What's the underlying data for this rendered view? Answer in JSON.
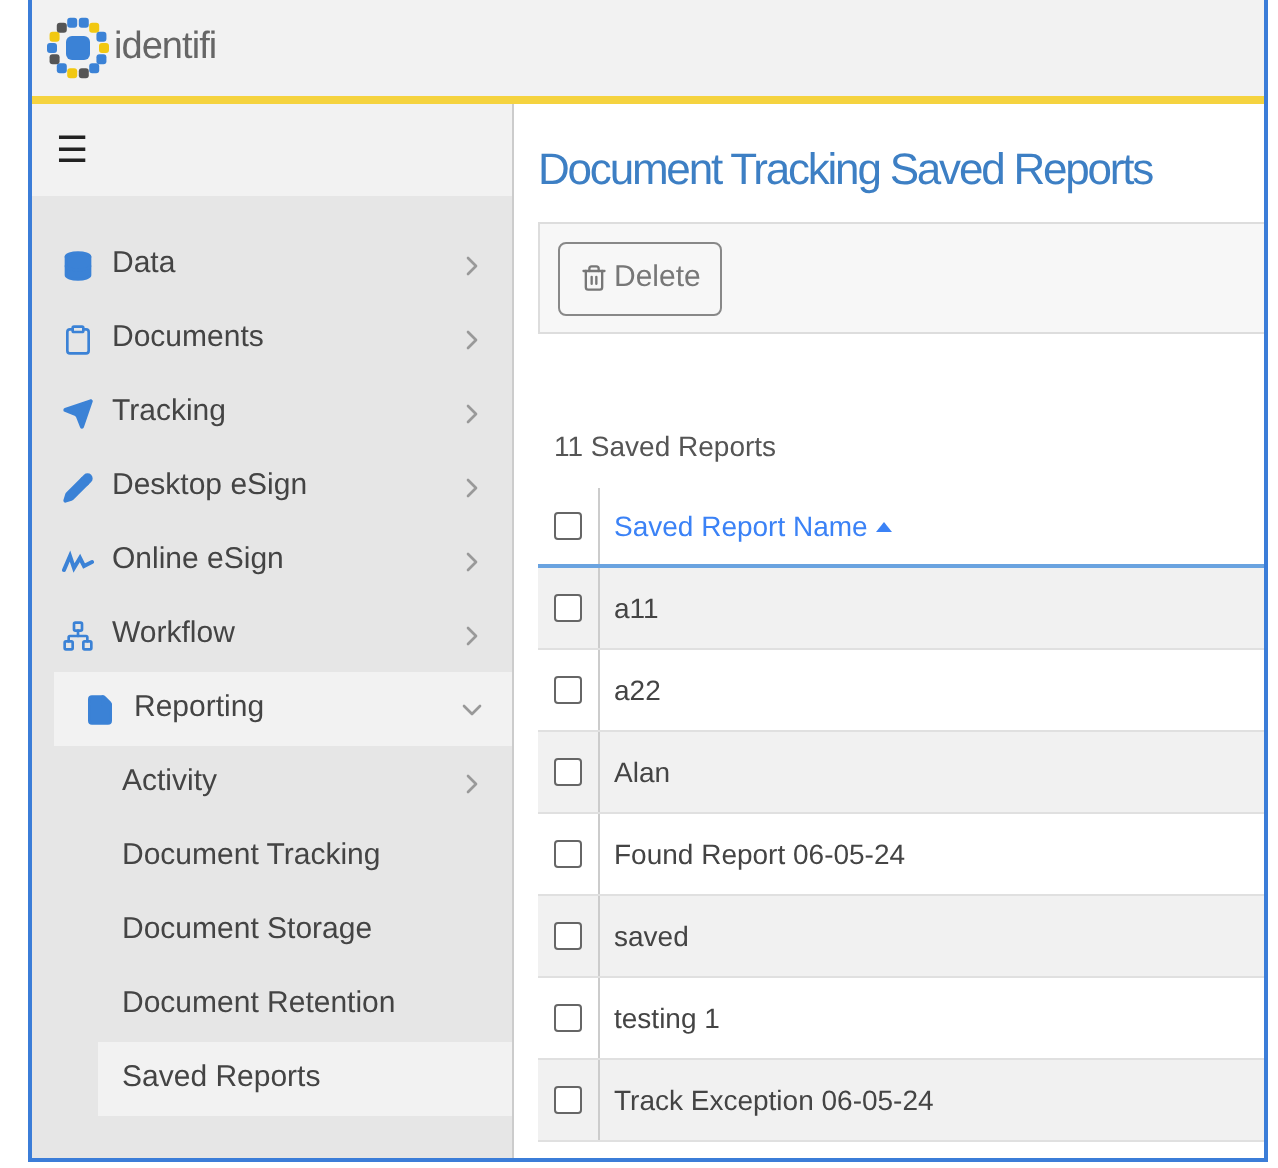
{
  "header": {
    "logo_text": "identifi",
    "menu_icon": "☰"
  },
  "sidebar": {
    "items": [
      {
        "label": "Data",
        "expanded": false
      },
      {
        "label": "Documents",
        "expanded": false
      },
      {
        "label": "Tracking",
        "expanded": false
      },
      {
        "label": "Desktop eSign",
        "expanded": false
      },
      {
        "label": "Online eSign",
        "expanded": false
      },
      {
        "label": "Workflow",
        "expanded": false
      },
      {
        "label": "Reporting",
        "expanded": true,
        "children": [
          {
            "label": "Activity",
            "selected": false,
            "has_submenu": true
          },
          {
            "label": "Document Tracking",
            "selected": false,
            "has_submenu": false
          },
          {
            "label": "Document Storage",
            "selected": false,
            "has_submenu": false
          },
          {
            "label": "Document Retention",
            "selected": false,
            "has_submenu": false
          },
          {
            "label": "Saved Reports",
            "selected": true,
            "has_submenu": false
          }
        ]
      }
    ]
  },
  "page": {
    "title": "Document Tracking Saved Reports",
    "toolbar": {
      "delete_button": "Delete"
    },
    "count": "11 Saved Reports",
    "table": {
      "column": {
        "label": "Saved Report Name",
        "sorted_ascending": true
      },
      "header_checked": false,
      "rows": [
        {
          "name": "a11",
          "checked": false
        },
        {
          "name": "a22",
          "checked": false
        },
        {
          "name": "Alan",
          "checked": false
        },
        {
          "name": "Found Report 06-05-24",
          "checked": false
        },
        {
          "name": "saved",
          "checked": false
        },
        {
          "name": "testing 1",
          "checked": false
        },
        {
          "name": "Track Exception 06-05-24",
          "checked": false
        }
      ]
    }
  }
}
